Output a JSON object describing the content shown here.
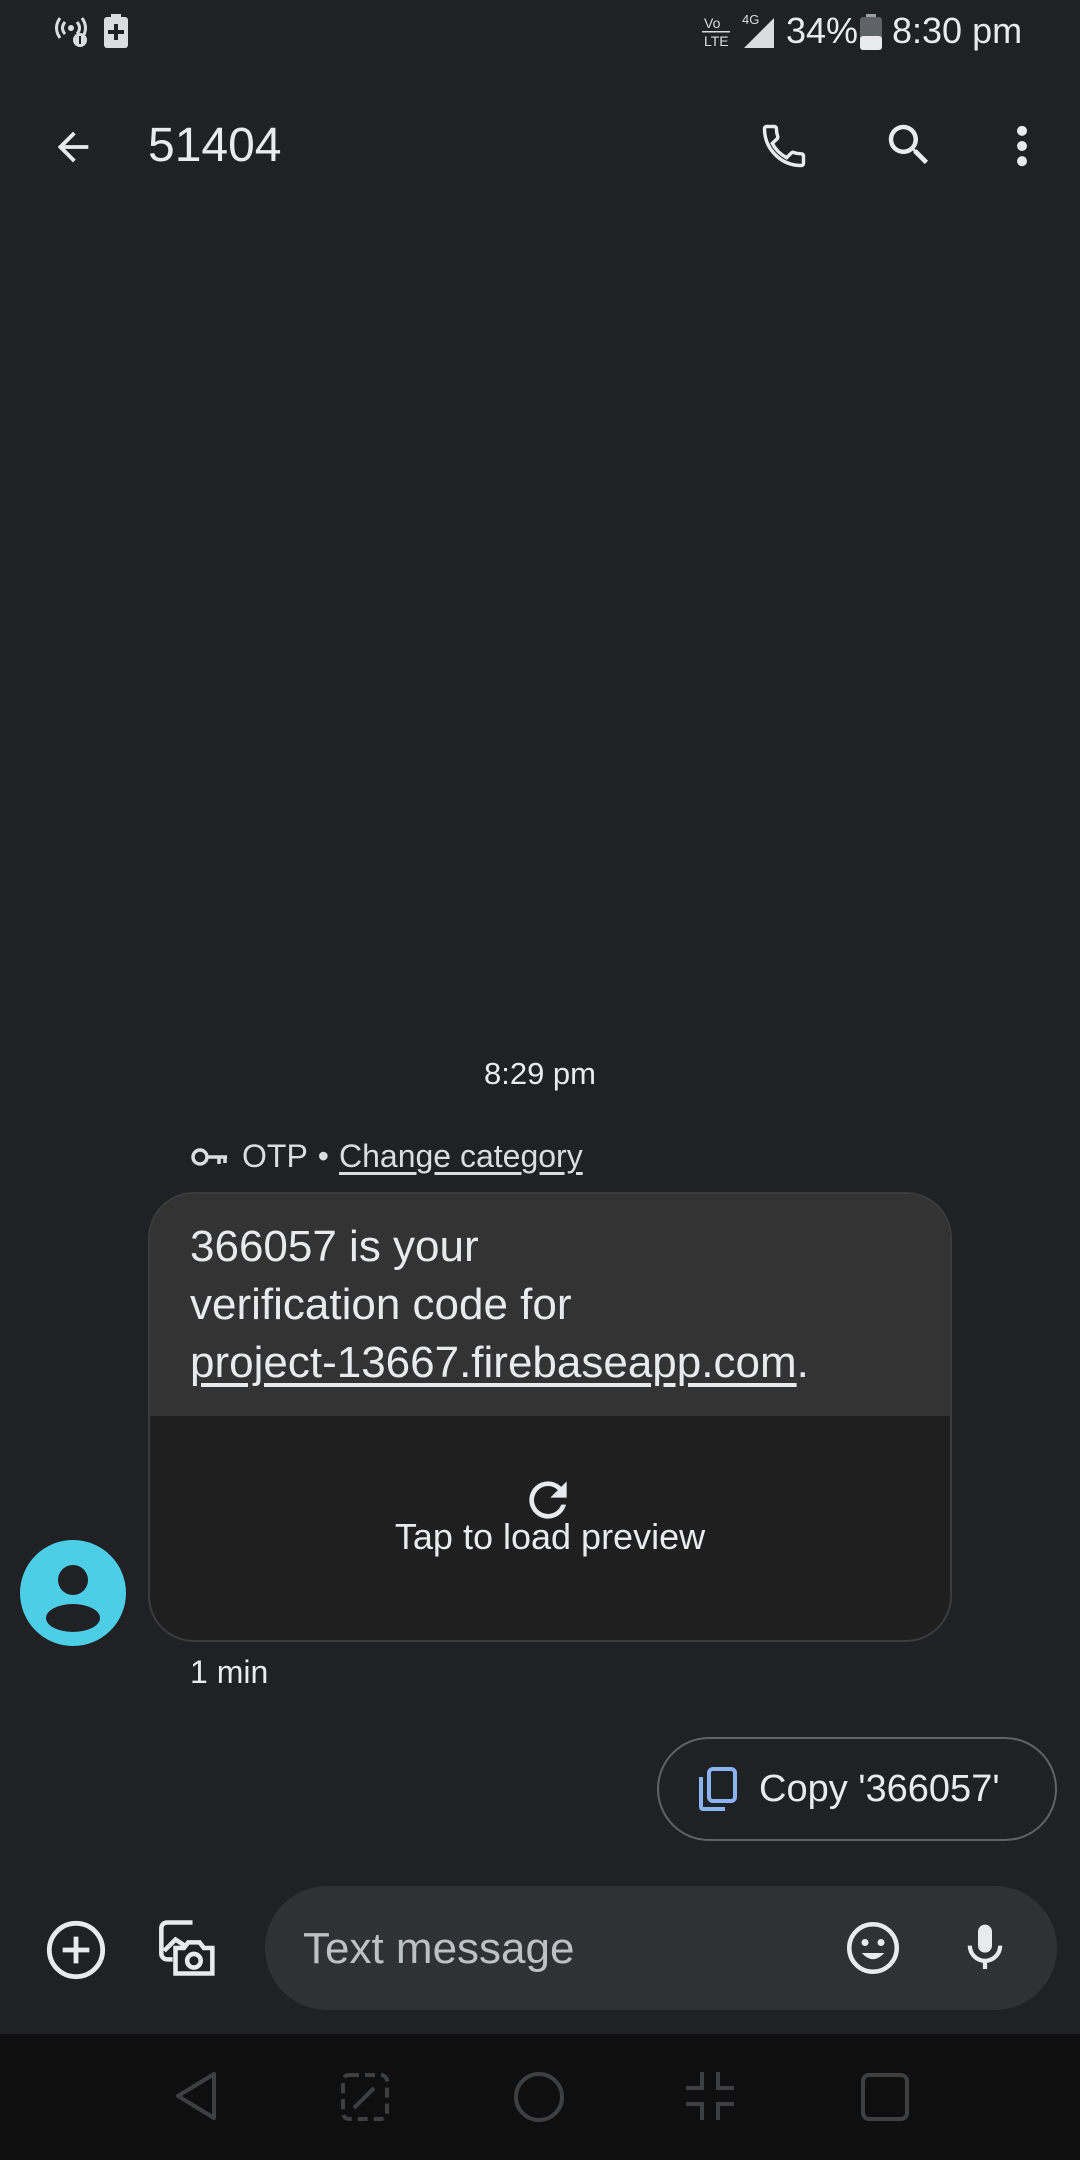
{
  "status_bar": {
    "battery": "34%",
    "time": "8:30 pm",
    "network": "4G"
  },
  "app_bar": {
    "title": "51404"
  },
  "conversation": {
    "time_separator": "8:29 pm",
    "category_label": "OTP",
    "category_dot": "•",
    "change_category": "Change category",
    "message": {
      "line1": "366057 is your",
      "line2": "verification code for",
      "url": "project-13667.firebaseapp.com",
      "trailing": "."
    },
    "preview_label": "Tap to load preview",
    "age": "1 min"
  },
  "suggestion": {
    "copy_label": "Copy '366057'"
  },
  "compose": {
    "placeholder": "Text message"
  },
  "colors": {
    "background": "#202124",
    "avatar": "#4ecde6",
    "copy_icon": "#8ab4f8"
  }
}
